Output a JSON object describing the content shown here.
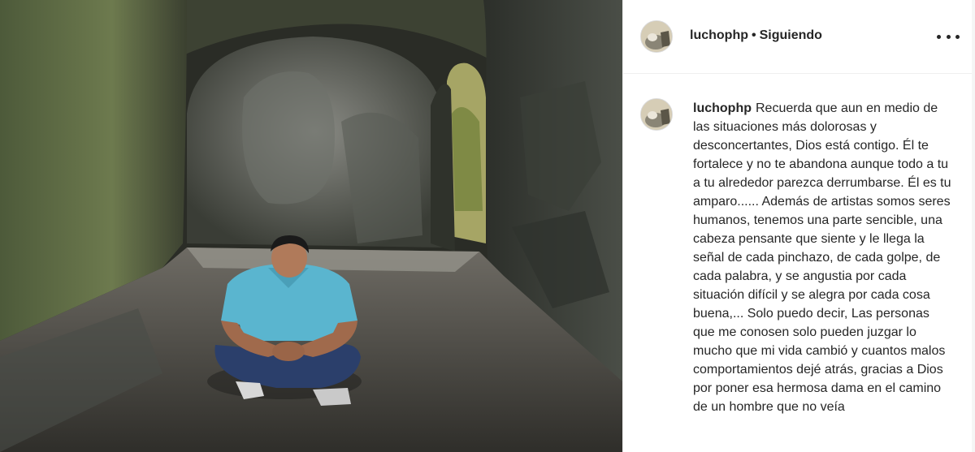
{
  "post": {
    "username": "luchophp",
    "separator": "•",
    "follow_status": "Siguiendo",
    "options_icon": "more-horizontal-icon",
    "photo_description_icon": "post-photo"
  },
  "caption": {
    "username": "luchophp",
    "text": "Recuerda que aun en medio de las situaciones más dolorosas y desconcertantes, Dios está contigo. Él te fortalece y no te abandona aunque todo a tu a tu alrededor parezca derrumbarse. Él es tu amparo...... Además de artistas somos seres humanos, tenemos una parte sencible, una cabeza pensante que siente y le llega la señal de cada pinchazo, de cada golpe, de cada palabra, y se angustia por cada situación difícil y se alegra por cada cosa buena,... Solo puedo decir, Las personas que me conosen solo pueden juzgar lo mucho que mi vida cambió y cuantos malos comportamientos dejé atrás, gracias a Dios por poner esa hermosa dama en el camino de un hombre que no veía"
  },
  "colors": {
    "text": "#262626",
    "border": "#efefef"
  }
}
